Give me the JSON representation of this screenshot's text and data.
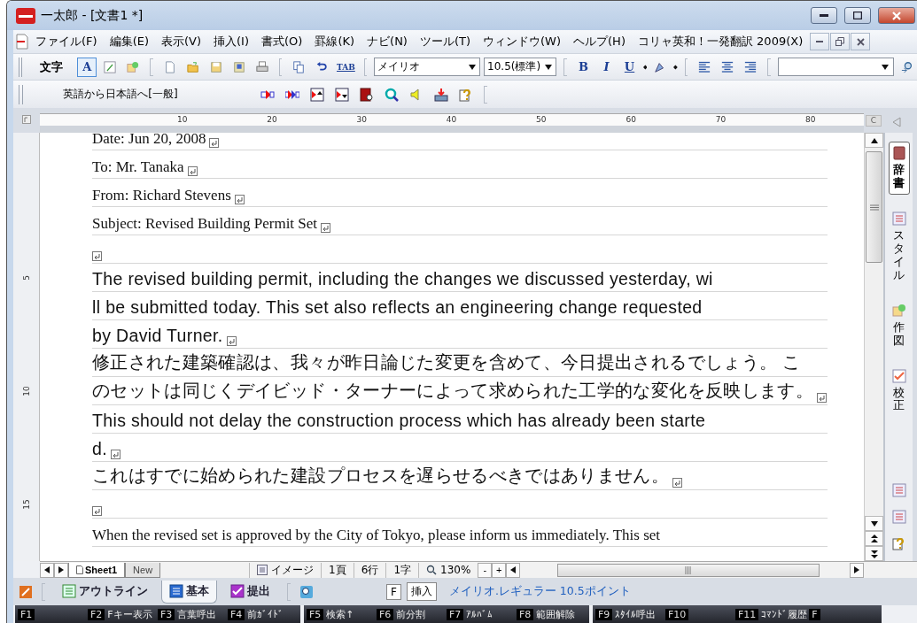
{
  "window": {
    "title": "一太郎 - [文書1 *]"
  },
  "menu": [
    "ファイル(F)",
    "編集(E)",
    "表示(V)",
    "挿入(I)",
    "書式(O)",
    "罫線(K)",
    "ナビ(N)",
    "ツール(T)",
    "ウィンドウ(W)",
    "ヘルプ(H)",
    "コリャ英和！一発翻訳 2009(X)"
  ],
  "toolbar": {
    "label": "文字",
    "mode_button": "A",
    "tab_button": "TAB",
    "font": "メイリオ",
    "size": "10.5(標準)",
    "format_buttons": [
      "B",
      "I",
      "U"
    ]
  },
  "translate_bar": {
    "label": "英語から日本語へ[一般]"
  },
  "ruler": {
    "ticks": [
      "10",
      "20",
      "30",
      "40",
      "50",
      "60",
      "70",
      "80"
    ],
    "corner": "C"
  },
  "vertical_ruler": [
    "5",
    "10",
    "15"
  ],
  "document": {
    "lines": [
      {
        "kind": "serif",
        "text": "Date: Jun 20, 2008",
        "return_mark": true
      },
      {
        "kind": "serif",
        "text": "To: Mr. Tanaka",
        "return_mark": true
      },
      {
        "kind": "serif",
        "text": "From: Richard Stevens",
        "return_mark": true
      },
      {
        "kind": "serif",
        "text": "Subject: Revised Building Permit Set",
        "return_mark": true
      },
      {
        "return_mark": true
      },
      {
        "kind": "sans",
        "text": "The revised building permit, including the changes we discussed yesterday, wi",
        "return_mark": false
      },
      {
        "kind": "sans",
        "text": "ll be submitted today. This set also reflects an engineering change requested",
        "return_mark": false
      },
      {
        "kind": "sans",
        "text": "by David Turner.",
        "return_mark": true
      },
      {
        "kind": "sans",
        "text": "修正された建築確認は、我々が昨日論じた変更を含めて、今日提出されるでしょう。 こ",
        "return_mark": false
      },
      {
        "kind": "sans",
        "text": "のセットは同じくデイビッド・ターナーによって求められた工学的な変化を反映します。",
        "return_mark": true
      },
      {
        "kind": "sans",
        "text": "This should not delay the construction process which has already been starte",
        "return_mark": false
      },
      {
        "kind": "sans",
        "text": "d.",
        "return_mark": true
      },
      {
        "kind": "sans",
        "text": "これはすでに始められた建設プロセスを遅らせるべきではありません。",
        "return_mark": true
      },
      {
        "return_mark": true
      },
      {
        "kind": "serif",
        "text": "When the revised set is approved by the City of Tokyo, please inform us immediately. This set",
        "return_mark": false
      }
    ]
  },
  "side_panel": [
    {
      "label": "辞書",
      "selected": true
    },
    {
      "label": "スタイル",
      "selected": false
    },
    {
      "label": "作図",
      "selected": false
    },
    {
      "label": "校正",
      "selected": false
    }
  ],
  "sheet_tabs": [
    {
      "label": "Sheet1",
      "selected": true
    },
    {
      "label": "New",
      "selected": false
    }
  ],
  "status": {
    "view": "イメージ",
    "page": "1頁",
    "line": "6行",
    "char": "1字",
    "zoom": "130%",
    "zoom_out": "-",
    "zoom_in": "+"
  },
  "mode_tabs": [
    {
      "label": "アウトライン",
      "selected": false
    },
    {
      "label": "基本",
      "selected": true
    },
    {
      "label": "提出",
      "selected": false
    }
  ],
  "input_mode": {
    "key": "F",
    "mode": "挿入"
  },
  "font_info": "メイリオ.レギュラー 10.5ポイント",
  "fkey_groups": [
    [
      {
        "key": "F1"
      },
      {
        "key": "F2",
        "label": "Fキー表示"
      },
      {
        "key": "F3",
        "label": "言葉呼出"
      },
      {
        "key": "F4",
        "label": "前ｶﾞｲﾄﾞ"
      }
    ],
    [
      {
        "key": "F5",
        "label": "検索↑"
      },
      {
        "key": "F6",
        "label": "前分割"
      },
      {
        "key": "F7",
        "label": "ｱﾙﾊﾞﾑ"
      },
      {
        "key": "F8",
        "label": "範囲解除"
      }
    ],
    [
      {
        "key": "F9",
        "label": "ｽﾀｲﾙ呼出"
      },
      {
        "key": "F10"
      },
      {
        "key": "F11",
        "label": "ｺﾏﾝﾄﾞ履歴"
      },
      {
        "key": "F"
      }
    ]
  ]
}
